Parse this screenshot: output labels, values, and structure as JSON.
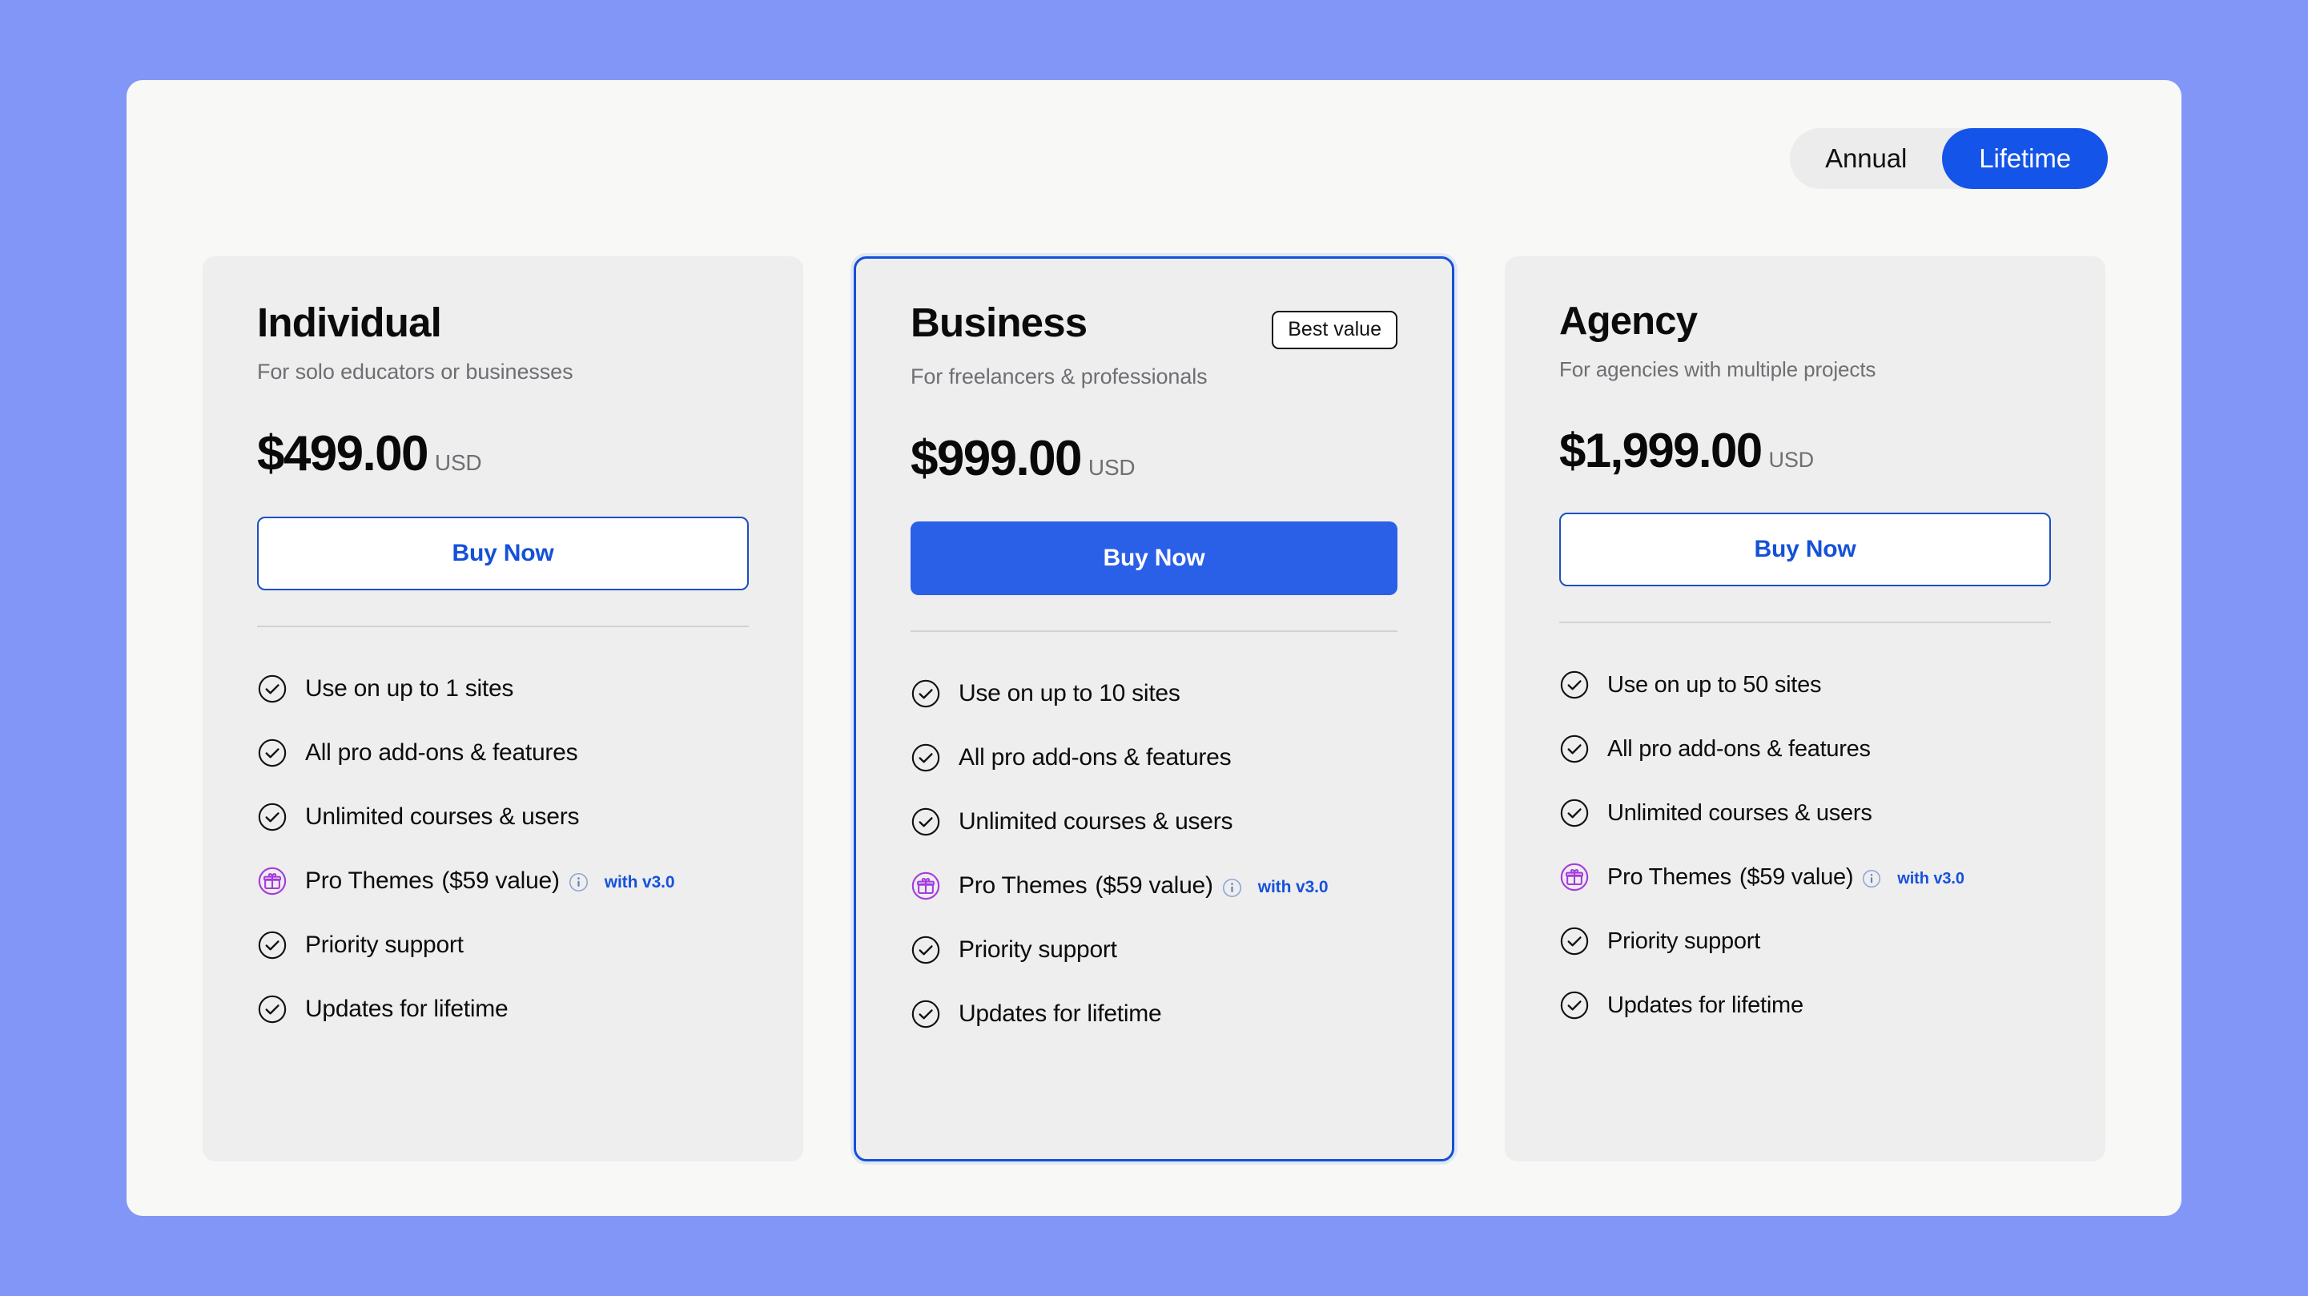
{
  "colors": {
    "page_background": "#8296f8",
    "panel_background": "#f8f8f7",
    "card_background": "#eeeeee",
    "accent_blue": "#1554e8",
    "featured_border": "#1450d8",
    "muted_text": "#6e6e73",
    "gift_purple": "#a53ae0",
    "divider": "#d2d2d2"
  },
  "billing_toggle": {
    "name": "billing-period-toggle",
    "options": [
      {
        "label": "Annual",
        "selected": false
      },
      {
        "label": "Lifetime",
        "selected": true
      }
    ]
  },
  "plans": [
    {
      "id": "individual",
      "name": "Individual",
      "subtitle": "For solo educators or businesses",
      "price": "$499.00",
      "currency": "USD",
      "badge": null,
      "featured": false,
      "cta": {
        "label": "Buy Now",
        "style": "outline"
      },
      "features": [
        {
          "icon": "check-circle-icon",
          "text": "Use on up to 1 sites"
        },
        {
          "icon": "check-circle-icon",
          "text": "All pro add-ons & features"
        },
        {
          "icon": "check-circle-icon",
          "text": "Unlimited courses & users"
        },
        {
          "icon": "gift-circle-icon",
          "text": "Pro Themes",
          "value": "($59 value)",
          "info": "info-icon",
          "version": "with v3.0"
        },
        {
          "icon": "check-circle-icon",
          "text": "Priority support"
        },
        {
          "icon": "check-circle-icon",
          "text": "Updates for lifetime"
        }
      ]
    },
    {
      "id": "business",
      "name": "Business",
      "subtitle": "For freelancers & professionals",
      "price": "$999.00",
      "currency": "USD",
      "badge": "Best value",
      "featured": true,
      "cta": {
        "label": "Buy Now",
        "style": "solid"
      },
      "features": [
        {
          "icon": "check-circle-icon",
          "text": "Use on up to 10 sites"
        },
        {
          "icon": "check-circle-icon",
          "text": "All pro add-ons & features"
        },
        {
          "icon": "check-circle-icon",
          "text": "Unlimited courses & users"
        },
        {
          "icon": "gift-circle-icon",
          "text": "Pro Themes",
          "value": "($59 value)",
          "info": "info-icon",
          "version": "with v3.0"
        },
        {
          "icon": "check-circle-icon",
          "text": "Priority support"
        },
        {
          "icon": "check-circle-icon",
          "text": "Updates for lifetime"
        }
      ]
    },
    {
      "id": "agency",
      "name": "Agency",
      "subtitle": "For agencies with multiple projects",
      "price": "$1,999.00",
      "currency": "USD",
      "badge": null,
      "featured": false,
      "cta": {
        "label": "Buy Now",
        "style": "outline"
      },
      "features": [
        {
          "icon": "check-circle-icon",
          "text": "Use on up to 50 sites"
        },
        {
          "icon": "check-circle-icon",
          "text": "All pro add-ons & features"
        },
        {
          "icon": "check-circle-icon",
          "text": "Unlimited courses & users"
        },
        {
          "icon": "gift-circle-icon",
          "text": "Pro Themes",
          "value": "($59 value)",
          "info": "info-icon",
          "version": "with v3.0"
        },
        {
          "icon": "check-circle-icon",
          "text": "Priority support"
        },
        {
          "icon": "check-circle-icon",
          "text": "Updates for lifetime"
        }
      ]
    }
  ]
}
